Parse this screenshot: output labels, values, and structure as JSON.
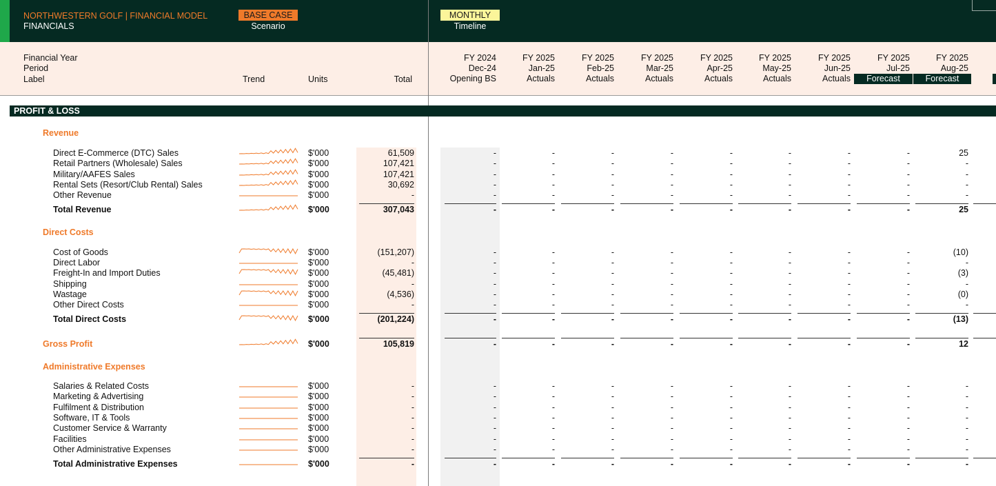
{
  "header": {
    "title": "NORTHWESTERN GOLF | FINANCIAL MODEL",
    "subtitle": "FINANCIALS",
    "scenario_value": "BASE CASE",
    "scenario_label": "Scenario",
    "timeline_value": "MONTHLY",
    "timeline_label": "Timeline"
  },
  "labels": {
    "financial_year": "Financial Year",
    "period": "Period",
    "label": "Label",
    "trend": "Trend",
    "units": "Units",
    "total": "Total"
  },
  "columns": [
    {
      "fy": "FY 2024",
      "period": "Dec-24",
      "label": "Opening BS",
      "forecast": false
    },
    {
      "fy": "FY 2025",
      "period": "Jan-25",
      "label": "Actuals",
      "forecast": false
    },
    {
      "fy": "FY 2025",
      "period": "Feb-25",
      "label": "Actuals",
      "forecast": false
    },
    {
      "fy": "FY 2025",
      "period": "Mar-25",
      "label": "Actuals",
      "forecast": false
    },
    {
      "fy": "FY 2025",
      "period": "Apr-25",
      "label": "Actuals",
      "forecast": false
    },
    {
      "fy": "FY 2025",
      "period": "May-25",
      "label": "Actuals",
      "forecast": false
    },
    {
      "fy": "FY 2025",
      "period": "Jun-25",
      "label": "Actuals",
      "forecast": false
    },
    {
      "fy": "FY 2025",
      "period": "Jul-25",
      "label": "Forecast",
      "forecast": true
    },
    {
      "fy": "FY 2025",
      "period": "Aug-25",
      "label": "Forecast",
      "forecast": true
    }
  ],
  "section_title": "PROFIT & LOSS",
  "colors": {
    "accent": "#ef7a2a",
    "dark": "#052a22",
    "peach": "#fdeee6",
    "green": "#1fa84a",
    "yellow": "#fbf59a"
  },
  "rows": [
    {
      "kind": "section",
      "label": "Revenue"
    },
    {
      "kind": "item",
      "label": "Direct E-Commerce (DTC) Sales",
      "units": "$'000",
      "total": "61,509",
      "values": [
        "-",
        "-",
        "-",
        "-",
        "-",
        "-",
        "-",
        "-",
        "25"
      ],
      "trend": "rev"
    },
    {
      "kind": "item",
      "label": "Retail Partners (Wholesale) Sales",
      "units": "$'000",
      "total": "107,421",
      "values": [
        "-",
        "-",
        "-",
        "-",
        "-",
        "-",
        "-",
        "-",
        "-"
      ],
      "trend": "rev"
    },
    {
      "kind": "item",
      "label": "Military/AAFES Sales",
      "units": "$'000",
      "total": "107,421",
      "values": [
        "-",
        "-",
        "-",
        "-",
        "-",
        "-",
        "-",
        "-",
        "-"
      ],
      "trend": "rev"
    },
    {
      "kind": "item",
      "label": "Rental Sets (Resort/Club Rental) Sales",
      "units": "$'000",
      "total": "30,692",
      "values": [
        "-",
        "-",
        "-",
        "-",
        "-",
        "-",
        "-",
        "-",
        "-"
      ],
      "trend": "rev"
    },
    {
      "kind": "item",
      "label": "Other Revenue",
      "units": "$'000",
      "total": "-",
      "values": [
        "-",
        "-",
        "-",
        "-",
        "-",
        "-",
        "-",
        "-",
        "-"
      ],
      "trend": "flat"
    },
    {
      "kind": "total",
      "label": "Total Revenue",
      "units": "$'000",
      "total": "307,043",
      "values": [
        "-",
        "-",
        "-",
        "-",
        "-",
        "-",
        "-",
        "-",
        "25"
      ],
      "trend": "rev"
    },
    {
      "kind": "section",
      "label": "Direct Costs"
    },
    {
      "kind": "item",
      "label": "Cost of Goods",
      "units": "$'000",
      "total": "(151,207)",
      "values": [
        "-",
        "-",
        "-",
        "-",
        "-",
        "-",
        "-",
        "-",
        "(10)"
      ],
      "trend": "cost"
    },
    {
      "kind": "item",
      "label": "Direct Labor",
      "units": "$'000",
      "total": "-",
      "values": [
        "-",
        "-",
        "-",
        "-",
        "-",
        "-",
        "-",
        "-",
        "-"
      ],
      "trend": "flat"
    },
    {
      "kind": "item",
      "label": "Freight-In and Import Duties",
      "units": "$'000",
      "total": "(45,481)",
      "values": [
        "-",
        "-",
        "-",
        "-",
        "-",
        "-",
        "-",
        "-",
        "(3)"
      ],
      "trend": "cost"
    },
    {
      "kind": "item",
      "label": "Shipping",
      "units": "$'000",
      "total": "-",
      "values": [
        "-",
        "-",
        "-",
        "-",
        "-",
        "-",
        "-",
        "-",
        "-"
      ],
      "trend": "flat"
    },
    {
      "kind": "item",
      "label": "Wastage",
      "units": "$'000",
      "total": "(4,536)",
      "values": [
        "-",
        "-",
        "-",
        "-",
        "-",
        "-",
        "-",
        "-",
        "(0)"
      ],
      "trend": "cost"
    },
    {
      "kind": "item",
      "label": "Other Direct Costs",
      "units": "$'000",
      "total": "-",
      "values": [
        "-",
        "-",
        "-",
        "-",
        "-",
        "-",
        "-",
        "-",
        "-"
      ],
      "trend": "flat"
    },
    {
      "kind": "total",
      "label": "Total Direct Costs",
      "units": "$'000",
      "total": "(201,224)",
      "values": [
        "-",
        "-",
        "-",
        "-",
        "-",
        "-",
        "-",
        "-",
        "(13)"
      ],
      "trend": "cost"
    },
    {
      "kind": "gross",
      "label": "Gross Profit",
      "units": "$'000",
      "total": "105,819",
      "values": [
        "-",
        "-",
        "-",
        "-",
        "-",
        "-",
        "-",
        "-",
        "12"
      ],
      "trend": "rev"
    },
    {
      "kind": "section",
      "label": "Administrative Expenses"
    },
    {
      "kind": "item",
      "label": "Salaries & Related Costs",
      "units": "$'000",
      "total": "-",
      "values": [
        "-",
        "-",
        "-",
        "-",
        "-",
        "-",
        "-",
        "-",
        "-"
      ],
      "trend": "flat"
    },
    {
      "kind": "item",
      "label": "Marketing & Advertising",
      "units": "$'000",
      "total": "-",
      "values": [
        "-",
        "-",
        "-",
        "-",
        "-",
        "-",
        "-",
        "-",
        "-"
      ],
      "trend": "flat"
    },
    {
      "kind": "item",
      "label": "Fulfilment & Distribution",
      "units": "$'000",
      "total": "-",
      "values": [
        "-",
        "-",
        "-",
        "-",
        "-",
        "-",
        "-",
        "-",
        "-"
      ],
      "trend": "flat"
    },
    {
      "kind": "item",
      "label": "Software, IT & Tools",
      "units": "$'000",
      "total": "-",
      "values": [
        "-",
        "-",
        "-",
        "-",
        "-",
        "-",
        "-",
        "-",
        "-"
      ],
      "trend": "flat"
    },
    {
      "kind": "item",
      "label": "Customer Service & Warranty",
      "units": "$'000",
      "total": "-",
      "values": [
        "-",
        "-",
        "-",
        "-",
        "-",
        "-",
        "-",
        "-",
        "-"
      ],
      "trend": "flat"
    },
    {
      "kind": "item",
      "label": "Facilities",
      "units": "$'000",
      "total": "-",
      "values": [
        "-",
        "-",
        "-",
        "-",
        "-",
        "-",
        "-",
        "-",
        "-"
      ],
      "trend": "flat"
    },
    {
      "kind": "item",
      "label": "Other Administrative Expenses",
      "units": "$'000",
      "total": "-",
      "values": [
        "-",
        "-",
        "-",
        "-",
        "-",
        "-",
        "-",
        "-",
        "-"
      ],
      "trend": "flat"
    },
    {
      "kind": "total",
      "label": "Total Administrative Expenses",
      "units": "$'000",
      "total": "-",
      "values": [
        "-",
        "-",
        "-",
        "-",
        "-",
        "-",
        "-",
        "-",
        "-"
      ],
      "trend": "flat"
    }
  ]
}
